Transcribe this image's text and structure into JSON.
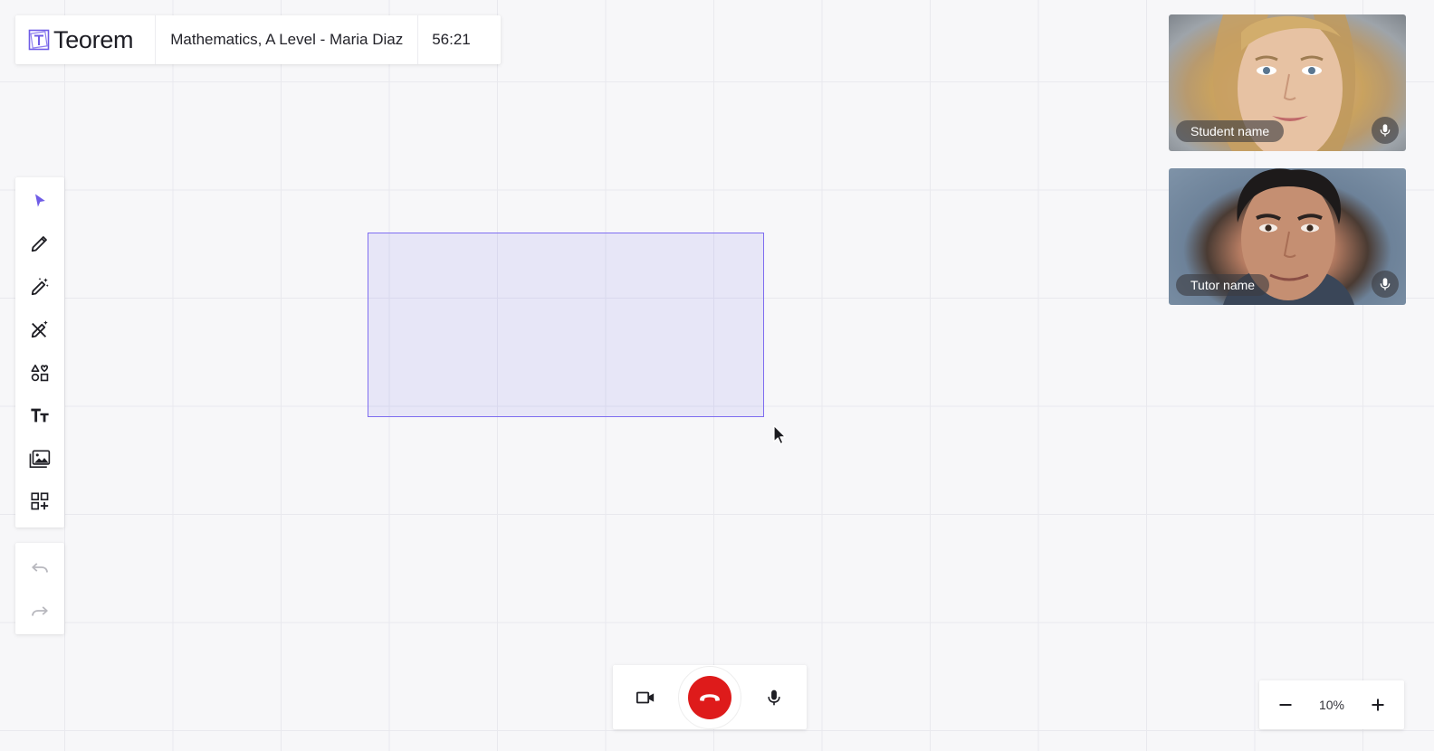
{
  "brand": {
    "name": "Teorem",
    "accent_color": "#6f5ce6"
  },
  "header": {
    "session_title": "Mathematics, A Level - Maria Diaz",
    "timer": "56:21"
  },
  "toolbar": {
    "tools": [
      {
        "id": "select",
        "icon": "cursor-arrow-icon",
        "active": true
      },
      {
        "id": "pencil",
        "icon": "pencil-icon",
        "active": false
      },
      {
        "id": "magic-pen",
        "icon": "magic-wand-icon",
        "active": false
      },
      {
        "id": "magic-eraser",
        "icon": "magic-eraser-icon",
        "active": false
      },
      {
        "id": "shapes",
        "icon": "shapes-icon",
        "active": false
      },
      {
        "id": "text",
        "icon": "text-size-icon",
        "active": false
      },
      {
        "id": "images",
        "icon": "image-library-icon",
        "active": false
      },
      {
        "id": "add-widget",
        "icon": "add-widget-icon",
        "active": false
      }
    ],
    "history": [
      {
        "id": "undo",
        "icon": "undo-icon",
        "enabled": false
      },
      {
        "id": "redo",
        "icon": "redo-icon",
        "enabled": false
      }
    ]
  },
  "participants": [
    {
      "role": "student",
      "name": "Student name",
      "mic_icon": "microphone-icon"
    },
    {
      "role": "tutor",
      "name": "Tutor name",
      "mic_icon": "microphone-icon"
    }
  ],
  "call_controls": {
    "camera_icon": "video-camera-icon",
    "hangup_icon": "phone-hangup-icon",
    "hangup_color": "#de1b1b",
    "mic_icon": "microphone-icon"
  },
  "zoom": {
    "value": "10%",
    "minus_icon": "minus-icon",
    "plus_icon": "plus-icon"
  }
}
